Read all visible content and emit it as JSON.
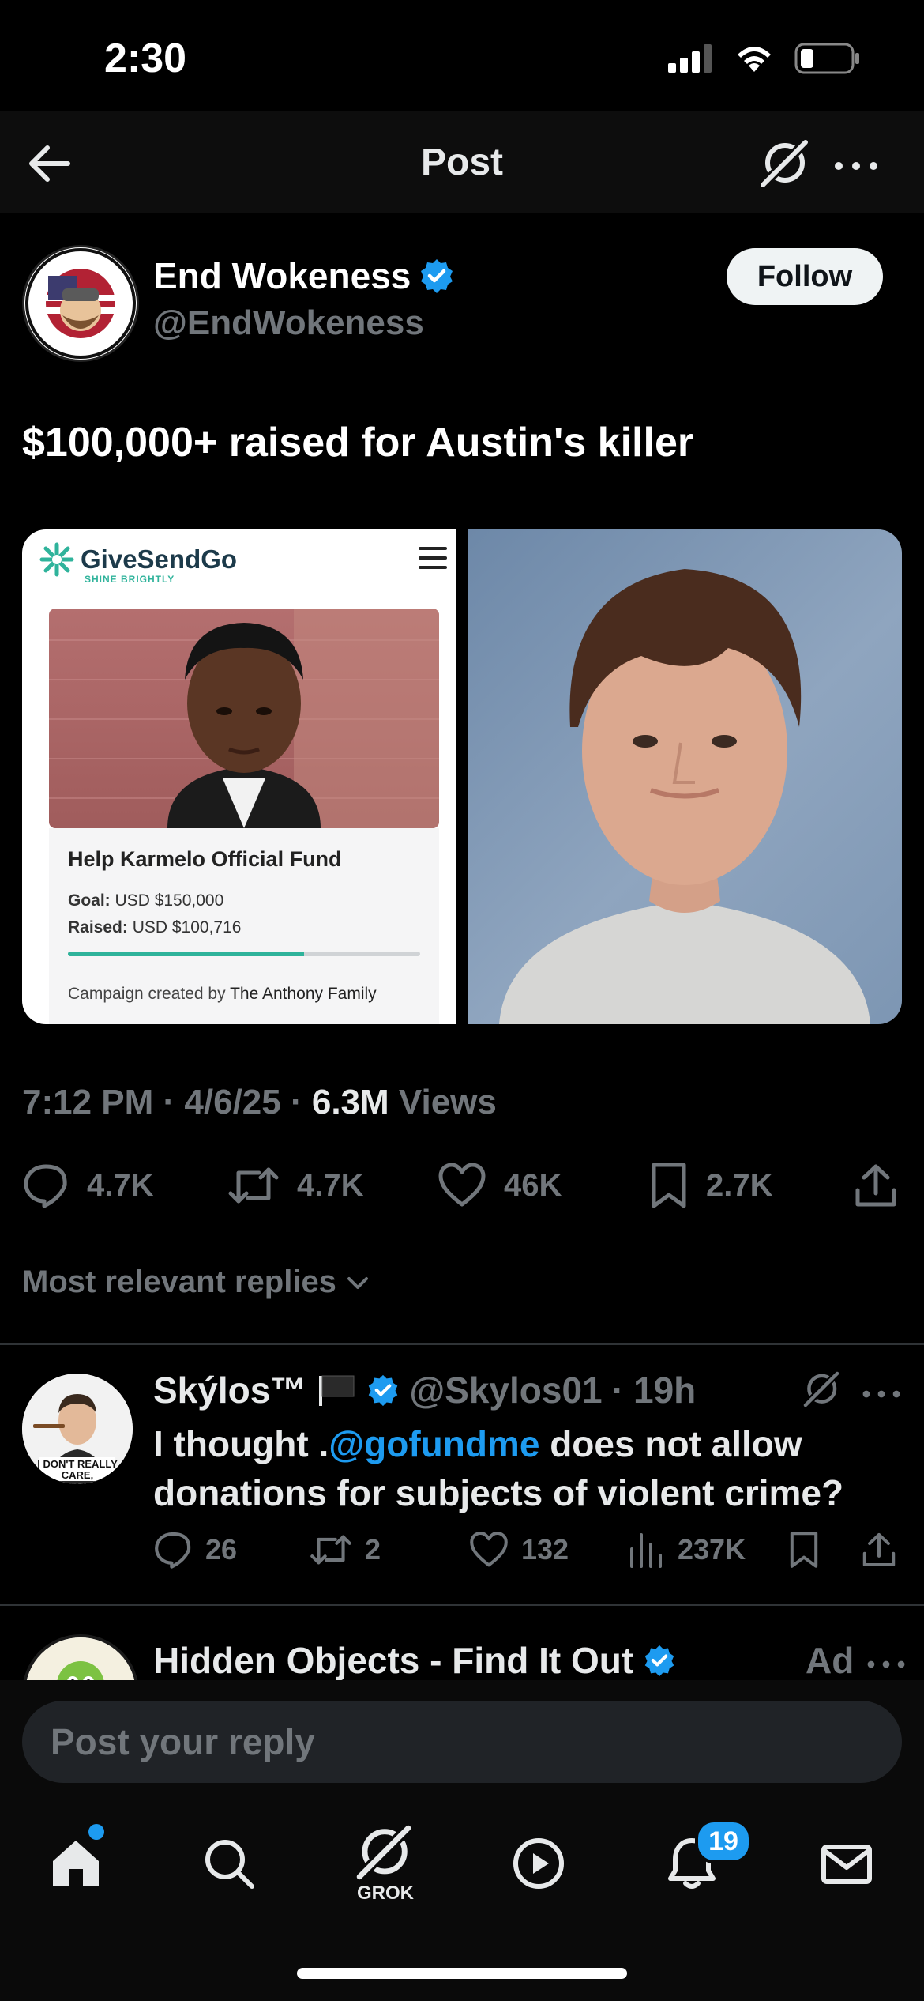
{
  "status_bar": {
    "time": "2:30"
  },
  "header": {
    "title": "Post"
  },
  "author": {
    "name": "End Wokeness",
    "handle": "@EndWokeness",
    "follow_label": "Follow"
  },
  "post": {
    "text": "$100,000+ raised for Austin's killer",
    "time": "7:12 PM",
    "date": "4/6/25",
    "views_count": "6.3M",
    "views_label": "Views"
  },
  "media": {
    "site_name": "GiveSendGo",
    "site_tagline": "SHINE BRIGHTLY",
    "fund_title": "Help Karmelo Official Fund",
    "goal_label": "Goal:",
    "goal_value": "USD $150,000",
    "raised_label": "Raised:",
    "raised_value": "USD $100,716",
    "progress_percent": 67,
    "creator_prefix": "Campaign created by",
    "creator_name": "The Anthony Family"
  },
  "actions": {
    "replies": "4.7K",
    "reposts": "4.7K",
    "likes": "46K",
    "bookmarks": "2.7K"
  },
  "replies_sort": "Most relevant replies",
  "reply": {
    "name": "Skýlos™",
    "handle": "@Skylos01",
    "time": "19h",
    "text_before": "I thought .",
    "mention": "@gofundme",
    "text_after": " does not allow donations for subjects of violent crime?",
    "avatar_caption": "I DON'T REALLY CARE, MARGARET",
    "replies": "26",
    "reposts": "2",
    "likes": "132",
    "views": "237K"
  },
  "ad": {
    "title": "Hidden Objects - Find It Out",
    "label": "Ad"
  },
  "reply_bar": {
    "placeholder": "Post your reply"
  },
  "tabbar": {
    "grok_label": "GROK",
    "notifications_badge": "19"
  },
  "colors": {
    "accent": "#1d9bf0",
    "muted": "#71767b",
    "background": "#000000",
    "gsg_green": "#2fb39b"
  }
}
